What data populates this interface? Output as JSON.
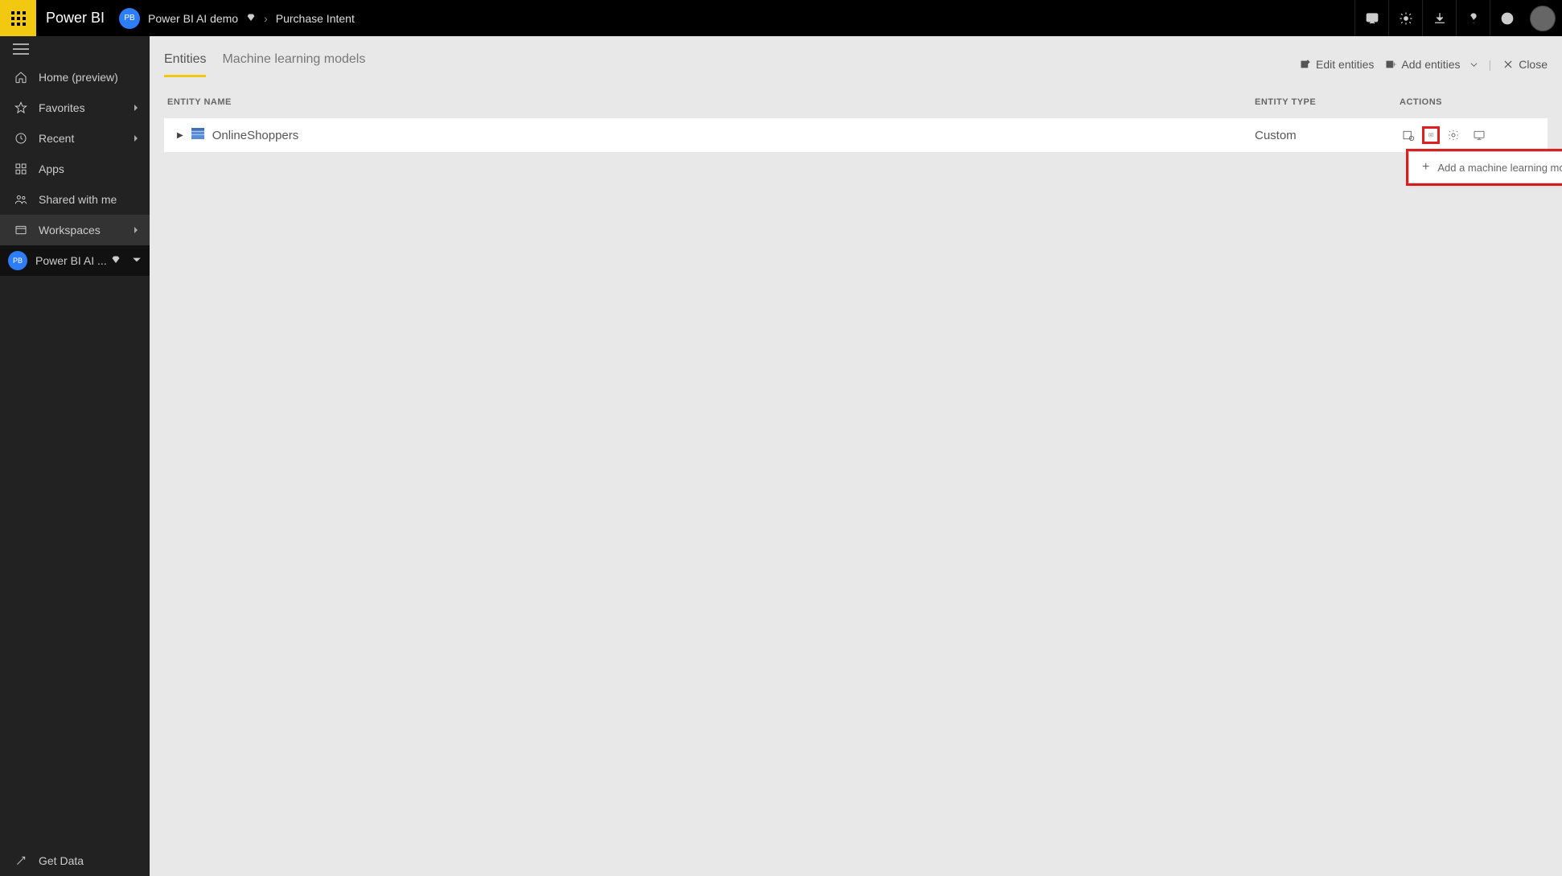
{
  "brand": "Power BI",
  "breadcrumb": {
    "workspace_pill": "PB",
    "workspace_name": "Power BI AI demo",
    "page": "Purchase Intent"
  },
  "sidebar": {
    "items": [
      {
        "label": "Home (preview)"
      },
      {
        "label": "Favorites"
      },
      {
        "label": "Recent"
      },
      {
        "label": "Apps"
      },
      {
        "label": "Shared with me"
      },
      {
        "label": "Workspaces"
      }
    ],
    "current_workspace_pill": "PB",
    "current_workspace_label": "Power BI AI ...",
    "get_data_label": "Get Data"
  },
  "tabs": {
    "entities": "Entities",
    "ml": "Machine learning models"
  },
  "actions": {
    "edit": "Edit entities",
    "add": "Add entities",
    "close": "Close"
  },
  "grid": {
    "col_name": "ENTITY NAME",
    "col_type": "ENTITY TYPE",
    "col_actions": "ACTIONS",
    "rows": [
      {
        "name": "OnlineShoppers",
        "type": "Custom"
      }
    ]
  },
  "dropdown": {
    "add_ml": "Add a machine learning model"
  }
}
